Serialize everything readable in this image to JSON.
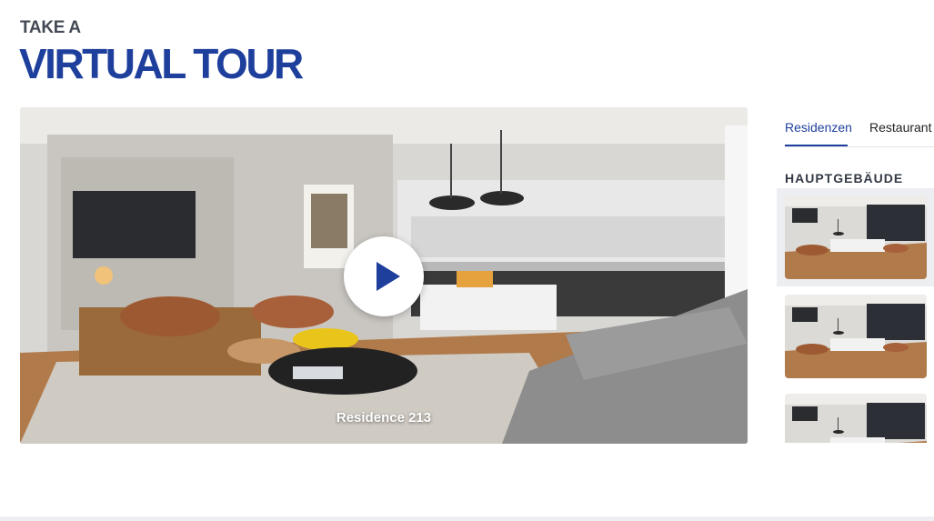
{
  "heading": {
    "kicker": "TAKE A",
    "title": "VIRTUAL TOUR"
  },
  "viewer": {
    "caption": "Residence 213",
    "play_icon": "play-icon"
  },
  "tabs": [
    {
      "label": "Residenzen",
      "active": true
    },
    {
      "label": "Restaurant",
      "active": false
    }
  ],
  "section": {
    "label": "HAUPTGEBÄUDE"
  },
  "thumbnails": [
    {
      "selected": true
    },
    {
      "selected": false
    },
    {
      "selected": false
    }
  ],
  "colors": {
    "accent": "#1e3f9c",
    "text_dark": "#444a55",
    "selected_bg": "#eceef1"
  }
}
